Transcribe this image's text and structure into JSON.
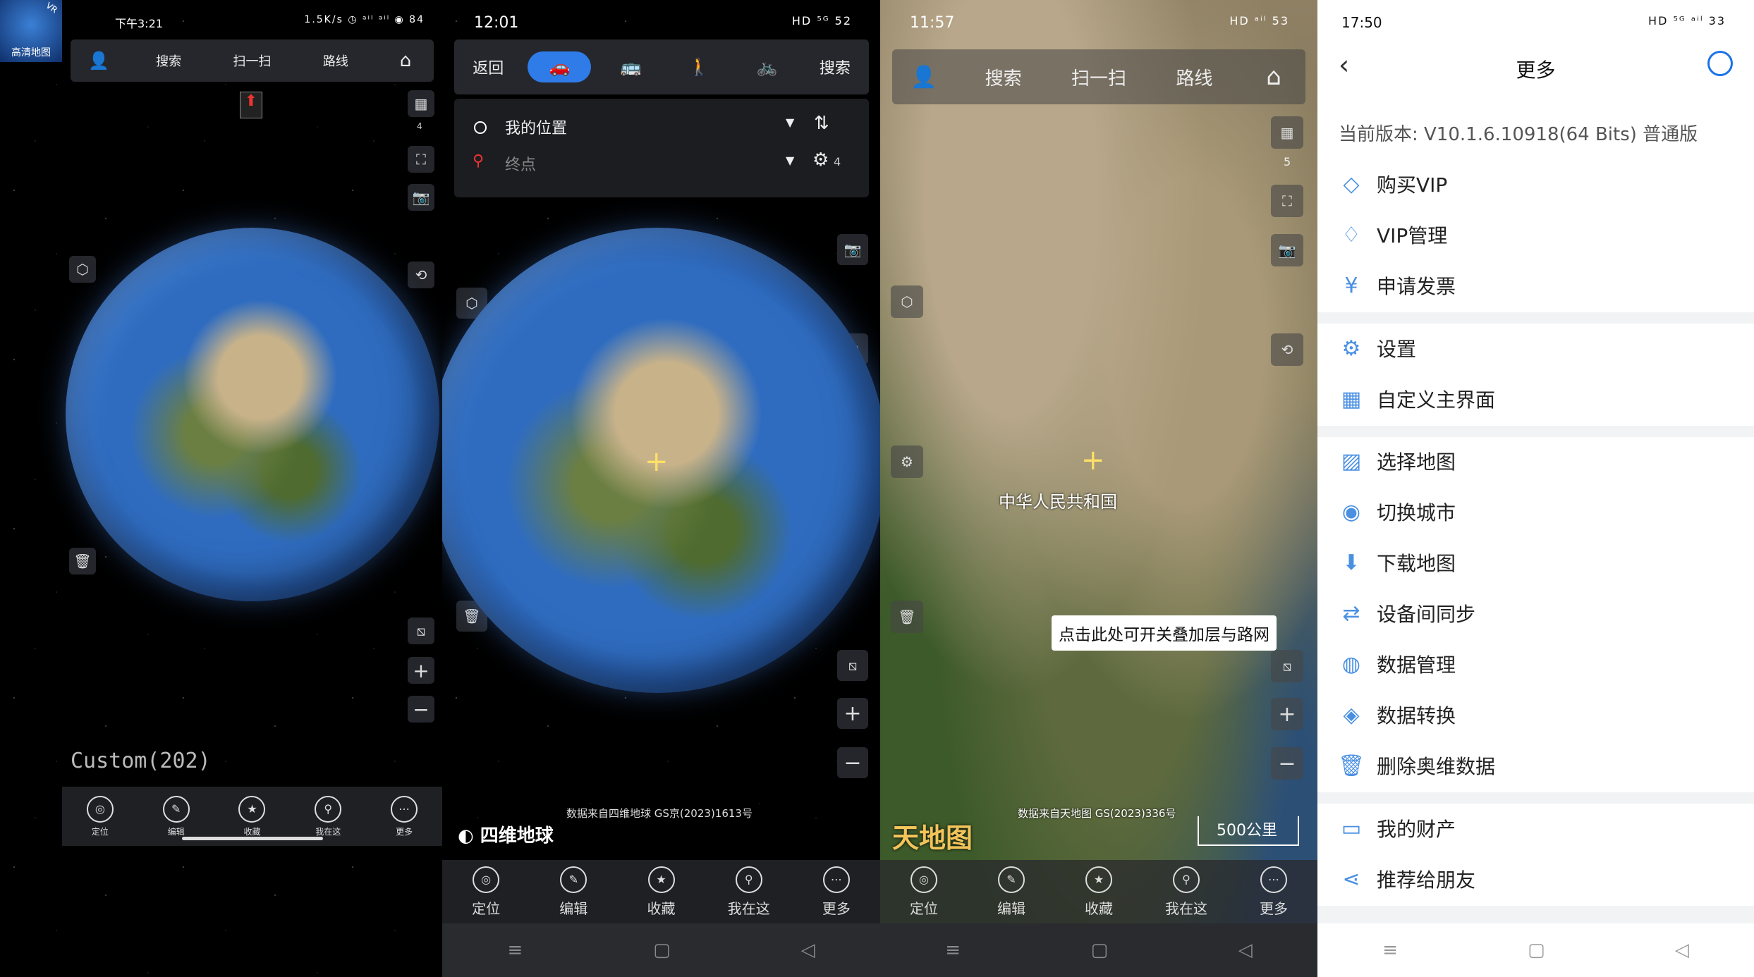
{
  "panel1": {
    "app_badge": {
      "text": "高清地图",
      "vr": "VR"
    },
    "status": {
      "time": "下午3:21",
      "right": "1.5K/s ◷ ᵃⁱˡ ᵃⁱˡ ◉ 84"
    },
    "topbar": [
      "搜索",
      "扫一扫",
      "路线"
    ],
    "map_count": "4",
    "custom_label": "Custom(202)",
    "bottom_nav": [
      "定位",
      "编辑",
      "收藏",
      "我在这",
      "更多"
    ]
  },
  "panel2": {
    "status": {
      "time": "12:01",
      "right": "HD ⁵ᴳ 52"
    },
    "topbar": {
      "back": "返回",
      "search": "搜索"
    },
    "route": {
      "my_location": "我的位置",
      "destination": "终点",
      "count": "4"
    },
    "data_source": "数据来自四维地球 GS京(2023)1613号",
    "logo": "四维地球",
    "bottom_nav": [
      "定位",
      "编辑",
      "收藏",
      "我在这",
      "更多"
    ]
  },
  "panel3": {
    "status": {
      "time": "11:57",
      "right": "HD ᵃⁱˡ 53"
    },
    "topbar": [
      "搜索",
      "扫一扫",
      "路线"
    ],
    "map_count": "5",
    "country_label": "中华人民共和国",
    "tooltip": "点击此处可开关叠加层与路网",
    "data_source": "数据来自天地图 GS(2023)336号",
    "logo": "天地图",
    "scale": "500公里",
    "bottom_nav": [
      "定位",
      "编辑",
      "收藏",
      "我在这",
      "更多"
    ]
  },
  "panel4": {
    "status": {
      "time": "17:50",
      "right": "HD ⁵ᴳ ᵃⁱˡ 33"
    },
    "title": "更多",
    "version": "当前版本: V10.1.6.10918(64 Bits) 普通版",
    "groups": [
      [
        "购买VIP",
        "VIP管理",
        "申请发票"
      ],
      [
        "设置",
        "自定义主界面"
      ],
      [
        "选择地图",
        "切换城市",
        "下载地图",
        "设备间同步",
        "数据管理",
        "数据转换",
        "删除奥维数据"
      ],
      [
        "我的财产",
        "推荐给朋友"
      ]
    ]
  },
  "colors": {
    "accent": "#1a73e8",
    "menu_icon": "#4a90e2"
  }
}
